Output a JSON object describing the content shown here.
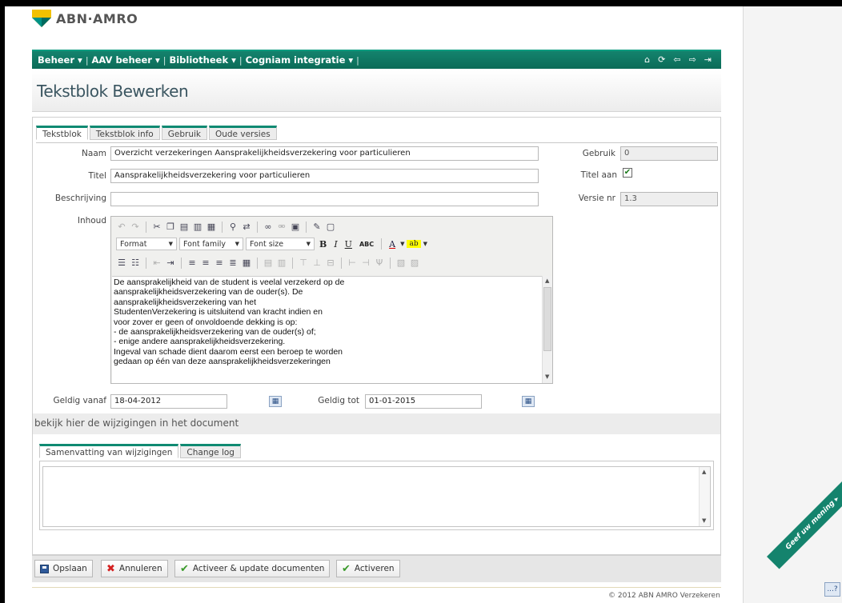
{
  "brand": {
    "name": "ABN·AMRO"
  },
  "nav": {
    "items": [
      "Beheer ▾",
      "AAV beheer ▾",
      "Bibliotheek ▾",
      "Cogniam integratie ▾"
    ],
    "icons": [
      "⌂",
      "⟳",
      "⇦",
      "⇨",
      "⇥"
    ]
  },
  "page": {
    "title": "Tekstblok Bewerken"
  },
  "tabs": [
    "Tekstblok",
    "Tekstblok info",
    "Gebruik",
    "Oude versies"
  ],
  "form": {
    "naam_label": "Naam",
    "naam_value": "Overzicht verzekeringen Aansprakelijkheidsverzekering voor particulieren",
    "titel_label": "Titel",
    "titel_value": "Aansprakelijkheidsverzekering voor particulieren",
    "beschrijving_label": "Beschrijving",
    "beschrijving_value": "",
    "inhoud_label": "Inhoud",
    "gebruik_label": "Gebruik",
    "gebruik_value": "0",
    "titel_aan_label": "Titel aan",
    "titel_aan_checked": true,
    "versie_label": "Versie nr",
    "versie_value": "1.3",
    "geldig_vanaf_label": "Geldig vanaf",
    "geldig_vanaf_value": "18-04-2012",
    "geldig_tot_label": "Geldig tot",
    "geldig_tot_value": "01-01-2015"
  },
  "editor": {
    "format_label": "Format",
    "font_family_label": "Font family",
    "font_size_label": "Font size",
    "content_lines": [
      "De aansprakelijkheid van de student is veelal verzekerd op de",
      "aansprakelijkheidsverzekering van de ouder(s). De",
      "aansprakelijkheidsverzekering van het",
      "StudentenVerzekering is uitsluitend van kracht indien en",
      "voor zover er geen of onvoldoende dekking is op:",
      "- de aansprakelijkheidsverzekering van de ouder(s) of;",
      "- enige andere aansprakelijkheidsverzekering.",
      "Ingeval van schade dient daarom eerst een beroep te worden",
      "gedaan op één van deze aansprakelijkheidsverzekeringen"
    ]
  },
  "changes": {
    "link_text": "bekijk hier de wijzigingen in het document"
  },
  "bottom_tabs": [
    "Samenvatting van wijzigingen",
    "Change log"
  ],
  "actions": {
    "save": "Opslaan",
    "cancel": "Annuleren",
    "activate_update": "Activeer & update documenten",
    "activate": "Activeren"
  },
  "footer": {
    "copyright": "© 2012 ABN AMRO Verzekeren"
  },
  "feedback": {
    "label": "Geef uw mening ▸",
    "chat": "...?"
  },
  "colors": {
    "brand_green": "#14836d",
    "logo_yellow": "#f2c100",
    "logo_teal": "#009286"
  }
}
